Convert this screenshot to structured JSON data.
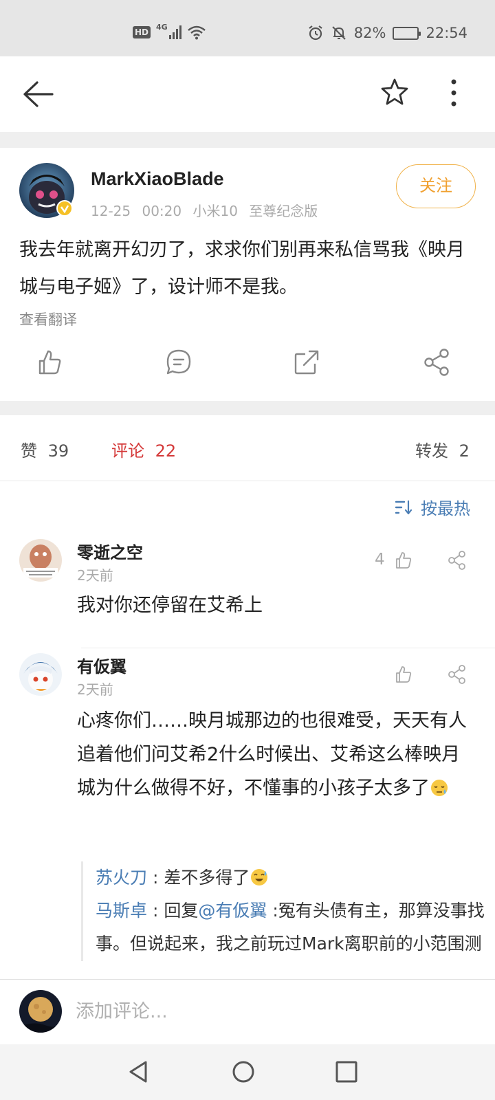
{
  "status_bar": {
    "hd": "HD",
    "network": "4G",
    "battery": "82%",
    "battery_level": 0.82,
    "time": "22:54"
  },
  "nav": {
    "back_icon": "arrow-left-icon",
    "favorite_icon": "star-outline-icon",
    "more_icon": "more-vertical-icon"
  },
  "post": {
    "author": "MarkXiaoBlade",
    "time": "12-25 00:20",
    "device": "小米10 至尊纪念版",
    "follow_label": "关注",
    "text": "我去年就离开幻刃了，求求你们别再来私信骂我《映月城与电子姬》了，设计师不是我。",
    "translate_label": "查看翻译",
    "colors": {
      "follow": "#f0a030",
      "verified_badge": "#f5c026"
    }
  },
  "stats": {
    "likes_label": "赞",
    "likes": "39",
    "comments_label": "评论",
    "comments": "22",
    "reposts_label": "转发",
    "reposts": "2",
    "active_color": "#d43838"
  },
  "sort": {
    "label": "按最热",
    "icon": "sort-icon",
    "color": "#4a7db4"
  },
  "comments": [
    {
      "user": "零逝之空",
      "time": "2天前",
      "likes": "4",
      "text": "我对你还停留在艾希上"
    },
    {
      "user": "有仮翼",
      "time": "2天前",
      "likes": "",
      "text": "心疼你们……映月城那边的也很难受，天天有人追着他们问艾希2什么时候出、艾希这么棒映月城为什么做得不好，不懂事的小孩子太多了",
      "replies": [
        {
          "user": "苏火刀",
          "sep": " : ",
          "text": "差不多得了"
        },
        {
          "user": "马斯卓",
          "sep": " : ",
          "prefix": "回复",
          "mention": "@有仮翼",
          "text": " :冤有头债有主，那算没事找事。但说起来，我之前玩过Mark离职前的小范围测试版，跟现在这玩意儿"
        }
      ]
    }
  ],
  "bottom": {
    "placeholder": "添加评论..."
  }
}
